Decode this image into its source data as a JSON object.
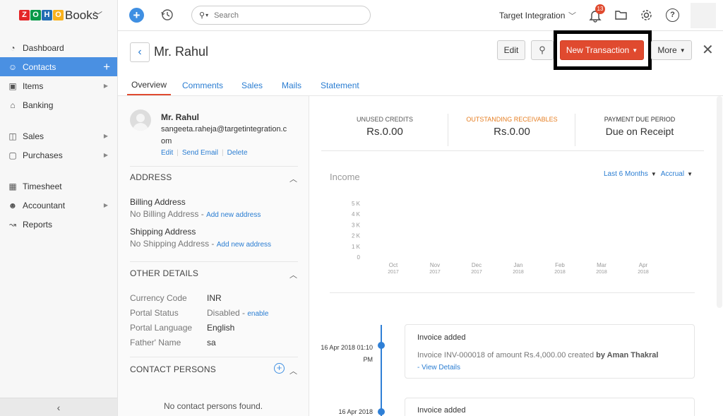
{
  "brand": {
    "logo_letters": [
      "Z",
      "O",
      "H",
      "O"
    ],
    "product": "Books"
  },
  "topbar": {
    "search_placeholder": "Search",
    "org_name": "Target Integration",
    "notification_count": "13"
  },
  "sidebar": {
    "items": [
      {
        "label": "Dashboard",
        "icon": "dashboard-icon"
      },
      {
        "label": "Contacts",
        "icon": "contacts-icon"
      },
      {
        "label": "Items",
        "icon": "items-icon"
      },
      {
        "label": "Banking",
        "icon": "bank-icon"
      },
      {
        "label": "Sales",
        "icon": "cart-icon"
      },
      {
        "label": "Purchases",
        "icon": "bag-icon"
      },
      {
        "label": "Timesheet",
        "icon": "calendar-icon"
      },
      {
        "label": "Accountant",
        "icon": "accountant-icon"
      },
      {
        "label": "Reports",
        "icon": "reports-icon"
      }
    ],
    "collapse_glyph": "‹"
  },
  "header": {
    "title": "Mr. Rahul",
    "edit_label": "Edit",
    "new_transaction_label": "New Transaction",
    "more_label": "More"
  },
  "tabs": [
    "Overview",
    "Comments",
    "Sales",
    "Mails",
    "Statement"
  ],
  "contact": {
    "name": "Mr. Rahul",
    "email_line1": "sangeeta.raheja@targetintegration.c",
    "email_line2": "om",
    "actions": [
      "Edit",
      "Send Email",
      "Delete"
    ]
  },
  "address": {
    "heading": "ADDRESS",
    "billing_label": "Billing Address",
    "billing_value": "No Billing Address",
    "shipping_label": "Shipping Address",
    "shipping_value": "No Shipping Address",
    "add_link": "Add new address"
  },
  "other_details": {
    "heading": "OTHER DETAILS",
    "rows": [
      {
        "label": "Currency Code",
        "value": "INR",
        "link": ""
      },
      {
        "label": "Portal Status",
        "value": "Disabled",
        "link": "enable"
      },
      {
        "label": "Portal Language",
        "value": "English",
        "link": ""
      },
      {
        "label": "Father' Name",
        "value": "sa",
        "link": ""
      }
    ]
  },
  "contact_persons": {
    "heading": "CONTACT PERSONS",
    "empty_text": "No contact persons found."
  },
  "summary": [
    {
      "label": "UNUSED CREDITS",
      "value": "Rs.0.00",
      "color": "#555555"
    },
    {
      "label": "OUTSTANDING RECEIVABLES",
      "value": "Rs.0.00",
      "color": "#e67e22"
    },
    {
      "label": "PAYMENT DUE PERIOD",
      "value": "Due on Receipt",
      "color": "#333333"
    }
  ],
  "income": {
    "title": "Income",
    "period_filter": "Last 6 Months",
    "basis_filter": "Accrual"
  },
  "chart_data": {
    "type": "bar",
    "title": "Income",
    "categories": [
      "Oct 2017",
      "Nov 2017",
      "Dec 2017",
      "Jan 2018",
      "Feb 2018",
      "Mar 2018",
      "Apr 2018"
    ],
    "values": [
      0,
      0,
      0,
      0,
      0,
      0,
      0
    ],
    "ylim": [
      0,
      5000
    ],
    "y_ticks": [
      "5 K",
      "4 K",
      "3 K",
      "2 K",
      "1 K",
      "0"
    ],
    "x_ticks": [
      [
        "Oct",
        "2017"
      ],
      [
        "Nov",
        "2017"
      ],
      [
        "Dec",
        "2017"
      ],
      [
        "Jan",
        "2018"
      ],
      [
        "Feb",
        "2018"
      ],
      [
        "Mar",
        "2018"
      ],
      [
        "Apr",
        "2018"
      ]
    ]
  },
  "timeline": [
    {
      "date": "16 Apr 2018 01:10",
      "date2": "PM",
      "title": "Invoice added",
      "desc": "Invoice INV-000018 of amount Rs.4,000.00 created",
      "by": "by Aman Thakral",
      "link": "- View Details"
    },
    {
      "date": "16 Apr 2018",
      "title": "Invoice added"
    }
  ],
  "colors": {
    "accent": "#4a90e2",
    "primary_button": "#e04a2f",
    "link": "#2a7dd2",
    "timeline": "#2f7fd6"
  }
}
